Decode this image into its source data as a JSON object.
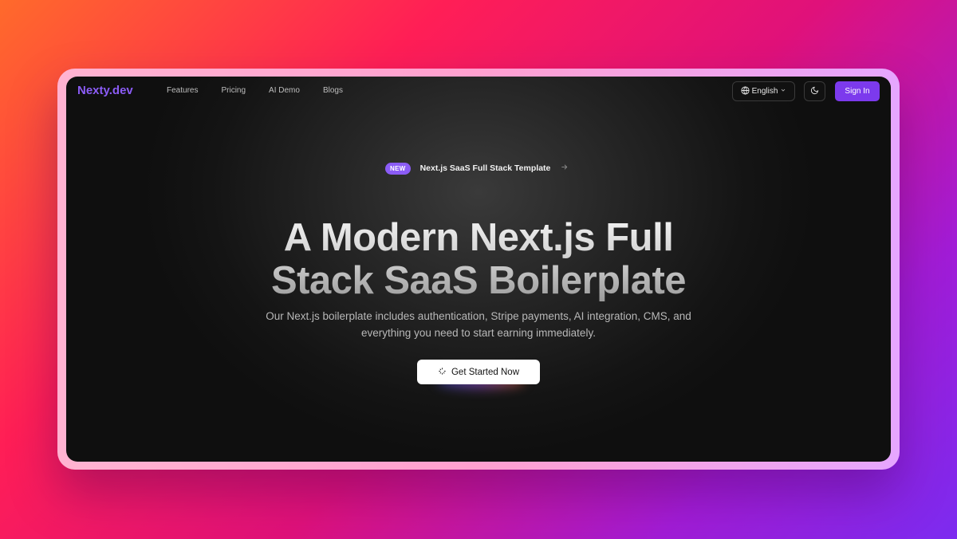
{
  "nav": {
    "logo": "Nexty.dev",
    "links": [
      "Features",
      "Pricing",
      "AI Demo",
      "Blogs"
    ],
    "language_label": "English",
    "signin_label": "Sign In"
  },
  "hero": {
    "badge_tag": "NEW",
    "badge_text": "Next.js SaaS Full Stack Template",
    "title_line1": "A Modern Next.js Full",
    "title_line2": "Stack SaaS Boilerplate",
    "subtitle_line1": "Our Next.js boilerplate includes authentication, Stripe payments, AI integration, CMS, and",
    "subtitle_line2": "everything you need to start earning immediately.",
    "cta_label": "Get Started Now"
  },
  "colors": {
    "accent": "#7c3aed",
    "badge": "#8b5cf6",
    "background_dark": "#141414"
  },
  "icons": [
    "globe-icon",
    "chevron-down-icon",
    "moon-icon",
    "arrow-right-icon",
    "sparkle-icon"
  ]
}
